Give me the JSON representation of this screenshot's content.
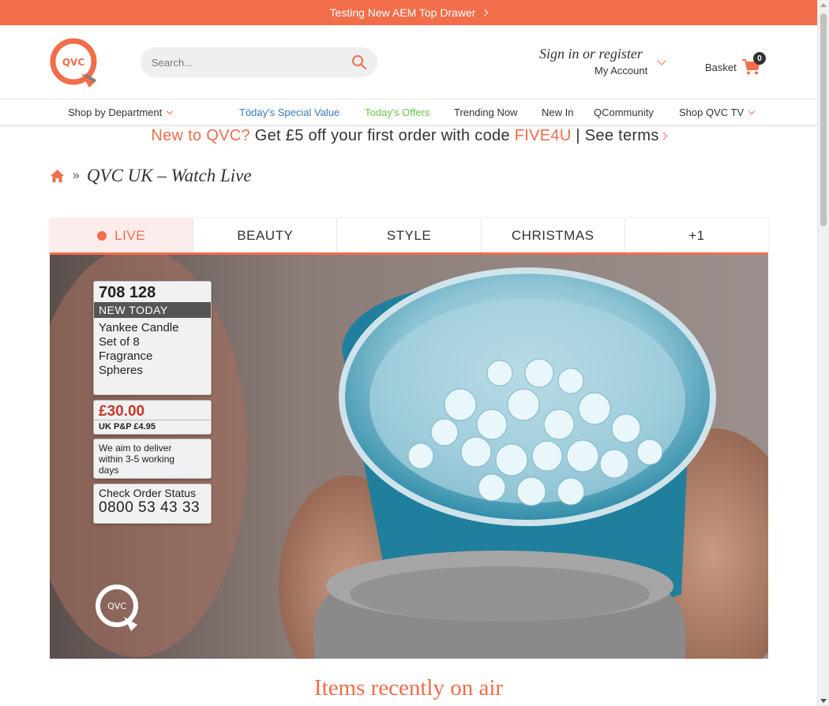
{
  "top_drawer": {
    "text": "Testing New AEM Top Drawer"
  },
  "header": {
    "logo_text": "QVC",
    "search_placeholder": "Search...",
    "signin_text": "Sign in or register",
    "my_account": "My Account",
    "basket_label": "Basket",
    "basket_count": "0"
  },
  "nav": {
    "shop_by_department": "Shop by Department",
    "todays_special_value": "Tōday's Special Value",
    "todays_offers": "Today's Offers",
    "trending_now": "Trending Now",
    "new_in": "New In",
    "qcommunity": "QCommunity",
    "shop_qvc_tv": "Shop QVC TV"
  },
  "promo": {
    "lead": "New to QVC?",
    "middle": " Get £5 off your first order with code ",
    "code": "FIVE4U",
    "terms": " | See terms"
  },
  "breadcrumb": {
    "separator": "»",
    "current": "QVC UK – Watch Live"
  },
  "tabs": [
    {
      "label": "LIVE",
      "active": true
    },
    {
      "label": "BEAUTY"
    },
    {
      "label": "STYLE"
    },
    {
      "label": "CHRISTMAS"
    },
    {
      "label": "+1"
    }
  ],
  "video": {
    "item_number": "708 128",
    "badge": "NEW TODAY",
    "product_name": "Yankee Candle\nSet of 8\nFragrance\nSpheres",
    "price": "£30.00",
    "postage": "UK P&P £4.95",
    "delivery": "We aim to deliver\nwithin 3-5 working\ndays",
    "order_status_label": "Check Order Status",
    "order_status_phone": "0800 53 43 33",
    "watermark": "QVC"
  },
  "section_title": "Items recently on air",
  "colors": {
    "accent": "#f26d4a",
    "offers_green": "#6cc24a",
    "special_blue": "#3a7bbf"
  }
}
